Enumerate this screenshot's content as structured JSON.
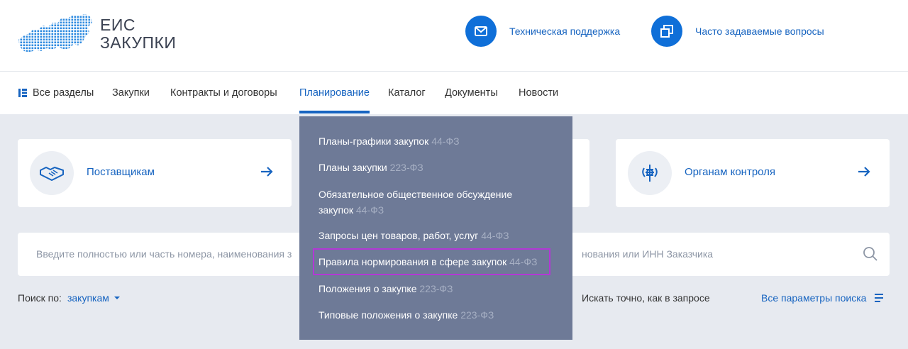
{
  "header": {
    "logo_line1": "ЕИС",
    "logo_line2": "ЗАКУПКИ",
    "support_label": "Техническая поддержка",
    "faq_label": "Часто задаваемые вопросы"
  },
  "nav": {
    "all_sections": "Все разделы",
    "purchases": "Закупки",
    "contracts": "Контракты и договоры",
    "planning": "Планирование",
    "catalog": "Каталог",
    "documents": "Документы",
    "news": "Новости"
  },
  "cards": {
    "suppliers": "Поставщикам",
    "control": "Органам контроля"
  },
  "search": {
    "placeholder_left": "Введите полностью или часть номера, наименования з",
    "placeholder_right": "нования или ИНН Заказчика"
  },
  "search_by": {
    "label": "Поиск по:",
    "value": "закупкам",
    "exact": "Искать точно, как в запросе",
    "all_params": "Все параметры поиска"
  },
  "dropdown": {
    "items": [
      {
        "label": "Планы-графики закупок",
        "law": "44-ФЗ"
      },
      {
        "label": "Планы закупки",
        "law": "223-ФЗ"
      },
      {
        "label": "Обязательное общественное обсуждение",
        "label2": "закупок",
        "law": "44-ФЗ"
      },
      {
        "label": "Запросы цен товаров, работ, услуг",
        "law": "44-ФЗ"
      },
      {
        "label": "Правила нормирования в сфере закупок",
        "law": "44-ФЗ"
      },
      {
        "label": "Положения о закупке",
        "law": "223-ФЗ"
      },
      {
        "label": "Типовые положения о закупке",
        "law": "223-ФЗ"
      }
    ]
  },
  "colors": {
    "accent": "#1764c0",
    "dropdown_bg": "#6e7a97",
    "highlight": "#b337d6"
  }
}
